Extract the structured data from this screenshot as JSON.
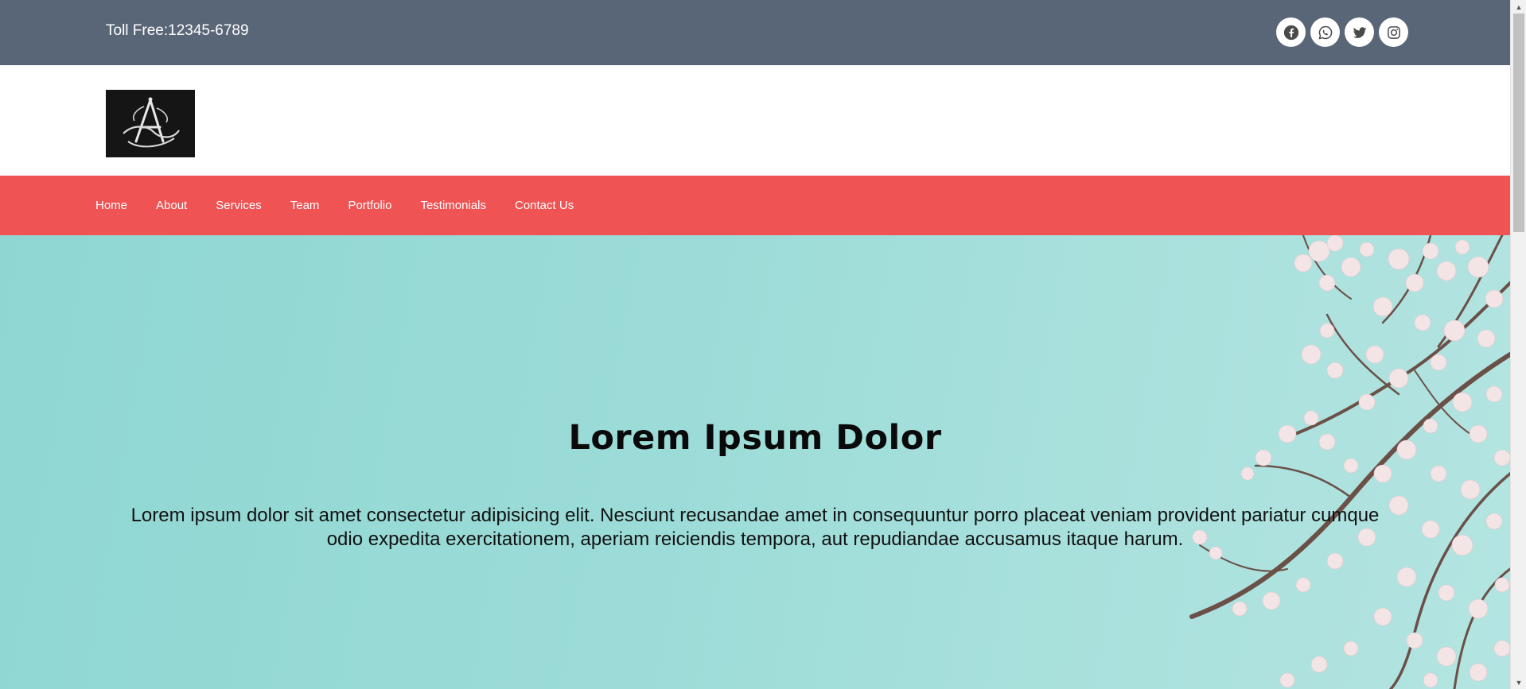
{
  "topbar": {
    "toll_free": "Toll Free:12345-6789",
    "socials": [
      {
        "icon": "facebook-icon"
      },
      {
        "icon": "whatsapp-icon"
      },
      {
        "icon": "twitter-icon"
      },
      {
        "icon": "instagram-icon"
      }
    ]
  },
  "logo": {
    "icon": "monogram-a-logo"
  },
  "nav": {
    "items": [
      "Home",
      "About",
      "Services",
      "Team",
      "Portfolio",
      "Testimonials",
      "Contact Us"
    ]
  },
  "hero": {
    "title": "Lorem Ipsum Dolor",
    "text": "Lorem ipsum dolor sit amet consectetur adipisicing elit. Nesciunt recusandae amet in consequuntur porro placeat veniam provident pariatur cumque odio expedita exercitationem, aperiam reiciendis tempora, aut repudiandae accusamus itaque harum."
  },
  "colors": {
    "topbar": "#596677",
    "nav": "#ef5353",
    "hero_sky": "#9cdcd8"
  }
}
